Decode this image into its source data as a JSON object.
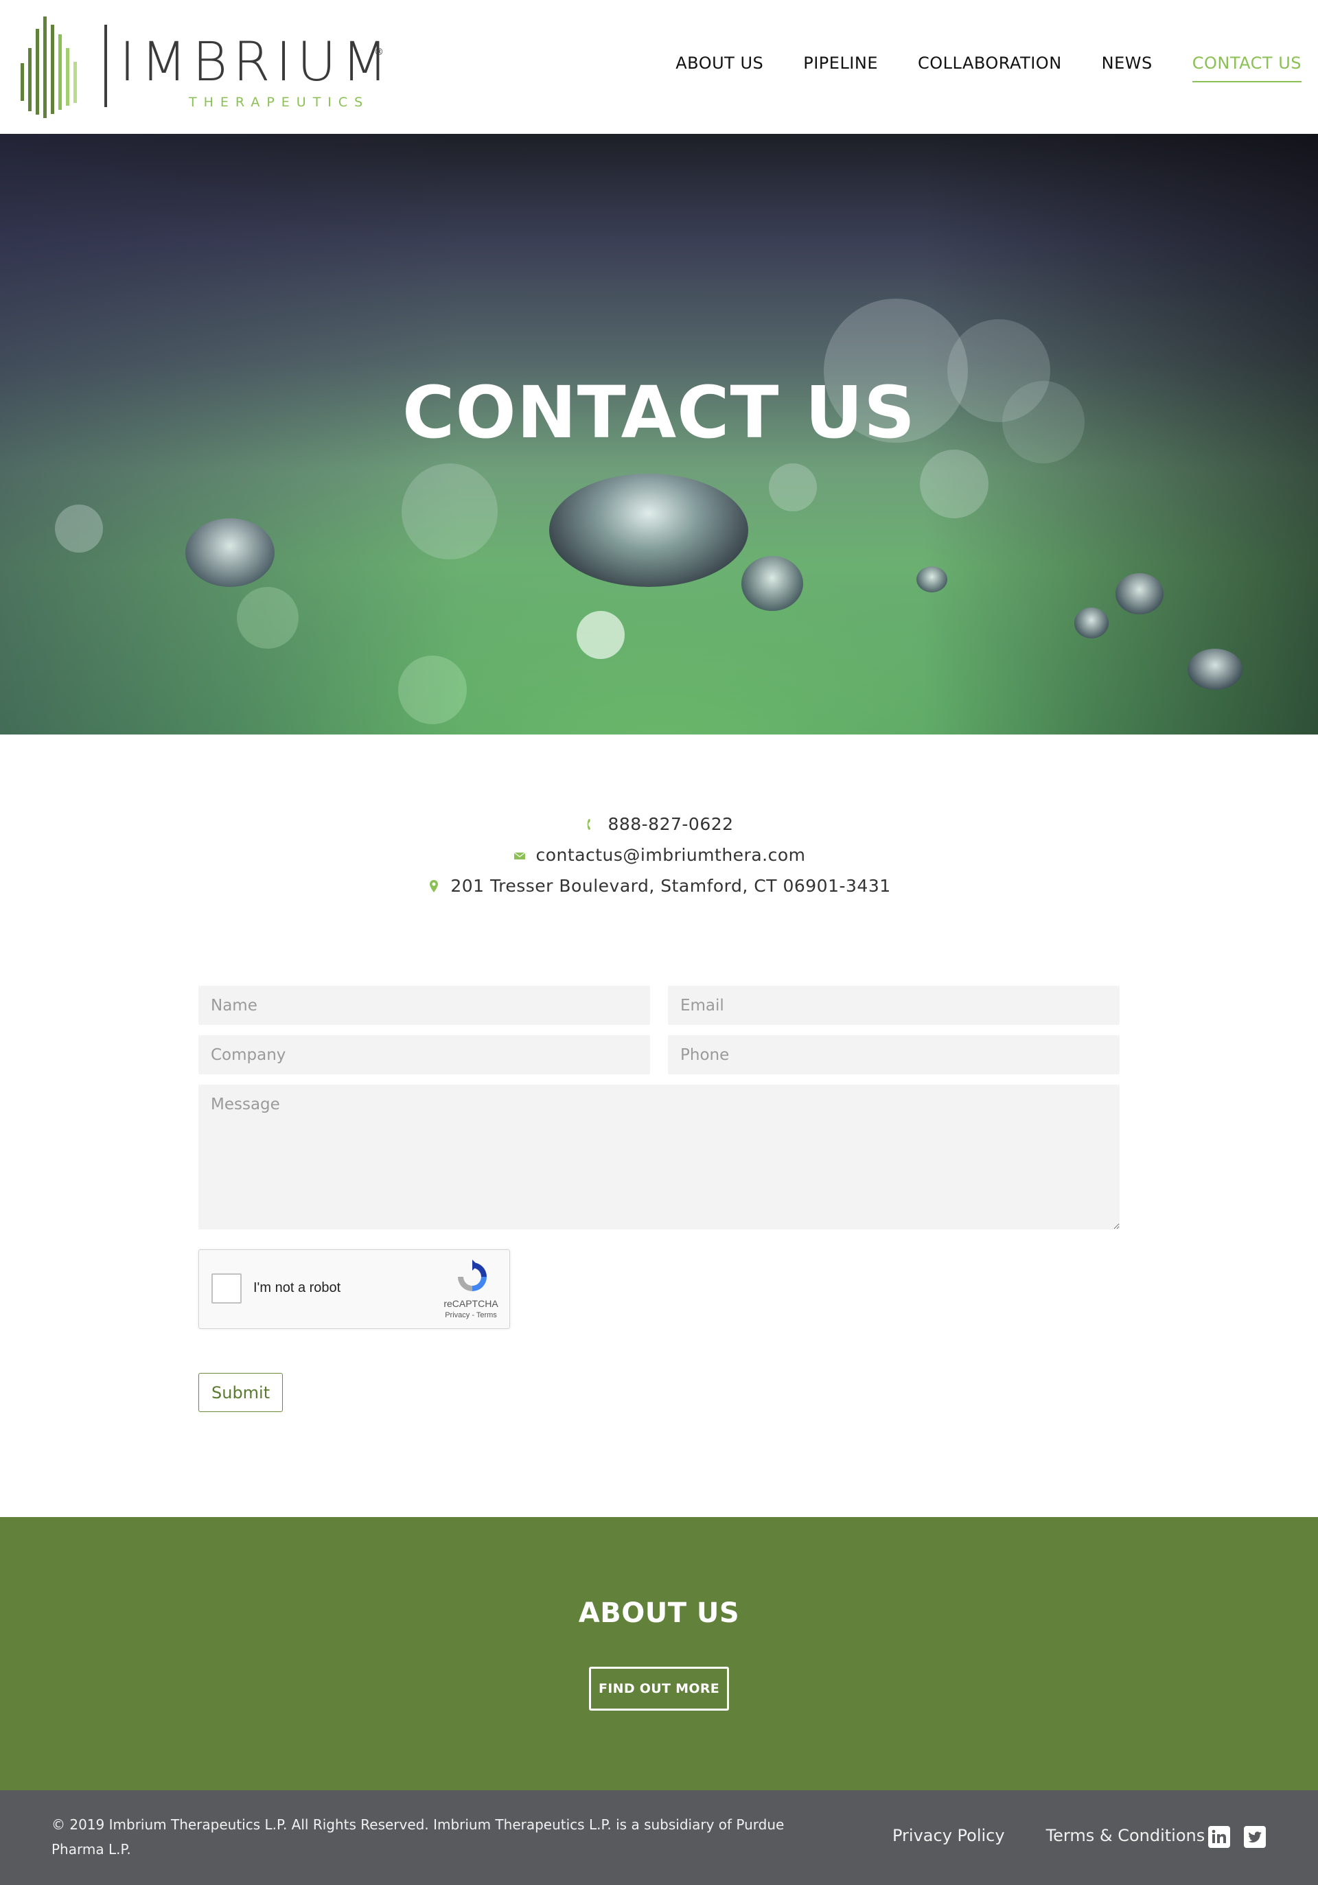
{
  "header": {
    "logo": {
      "wordmark": "IMBRIUM",
      "registered": "®",
      "tagline": "THERAPEUTICS"
    },
    "nav": [
      {
        "label": "ABOUT US",
        "active": false
      },
      {
        "label": "PIPELINE",
        "active": false
      },
      {
        "label": "COLLABORATION",
        "active": false
      },
      {
        "label": "NEWS",
        "active": false
      },
      {
        "label": "CONTACT US",
        "active": true
      }
    ]
  },
  "hero": {
    "title": "CONTACT US"
  },
  "contact": {
    "phone": "888-827-0622",
    "email": "contactus@imbriumthera.com",
    "address": "201 Tresser Boulevard, Stamford, CT 06901-3431"
  },
  "form": {
    "name_placeholder": "Name",
    "email_placeholder": "Email",
    "company_placeholder": "Company",
    "phone_placeholder": "Phone",
    "message_placeholder": "Message",
    "recaptcha": {
      "label": "I'm not a robot",
      "brand": "reCAPTCHA",
      "links": "Privacy - Terms"
    },
    "submit_label": "Submit"
  },
  "about_band": {
    "title": "ABOUT US",
    "button_label": "FIND OUT MORE"
  },
  "footer": {
    "copyright": "© 2019 Imbrium Therapeutics L.P. All Rights Reserved. Imbrium Therapeutics L.P. is a subsidiary of Purdue Pharma L.P.",
    "links": [
      "Privacy Policy",
      "Terms & Conditions"
    ],
    "social": [
      "linkedin-icon",
      "twitter-icon"
    ]
  },
  "colors": {
    "accent_green": "#8bc055",
    "band_green": "#62813a",
    "footer_gray": "#595a5d",
    "field_bg": "#f3f3f3"
  }
}
